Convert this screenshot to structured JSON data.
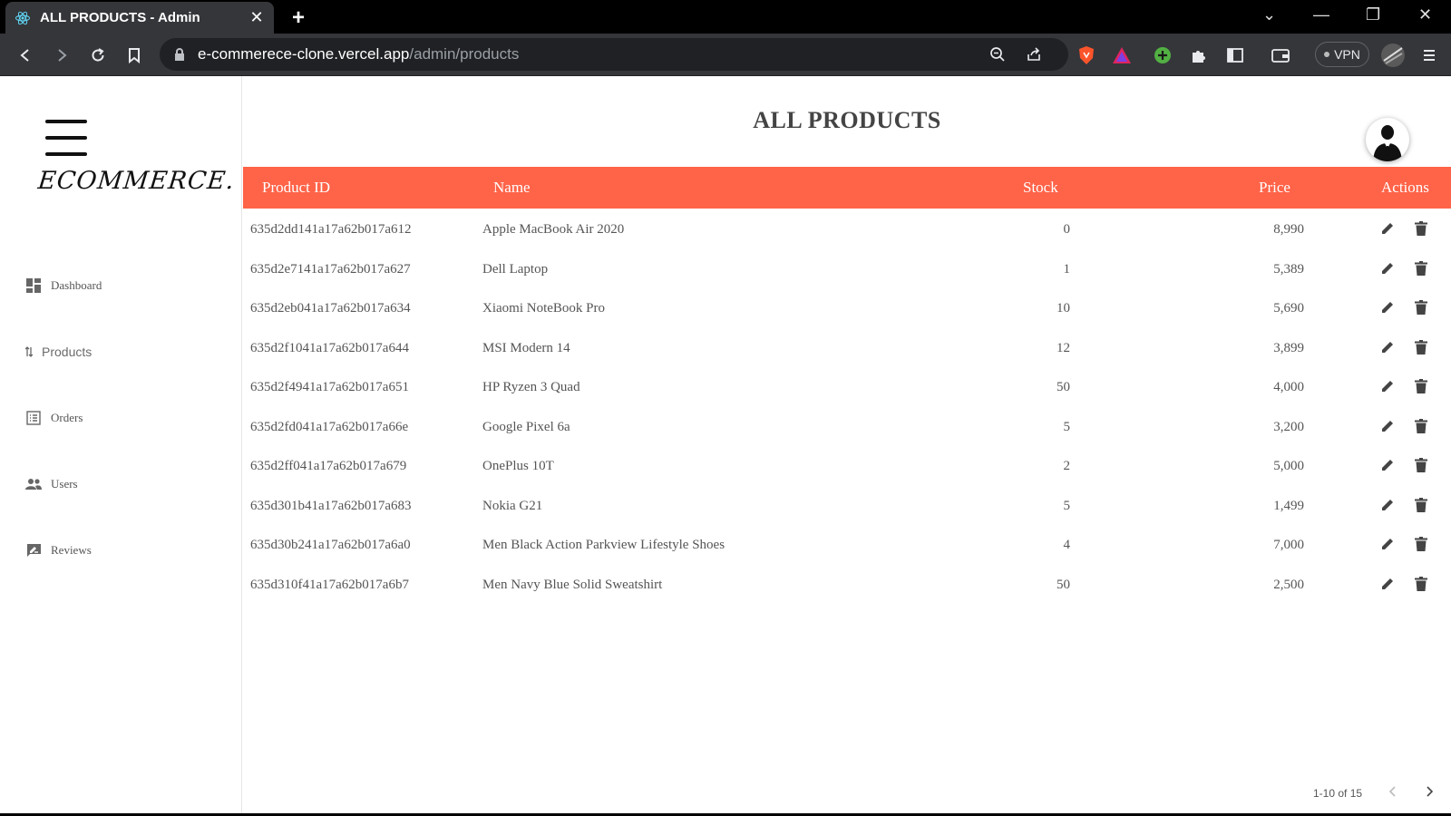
{
  "browser": {
    "tab_title": "ALL PRODUCTS - Admin",
    "tab_close": "✕",
    "new_tab": "+",
    "url_host": "e-commerece-clone.vercel.app",
    "url_path": "/admin/products",
    "vpn_label": "VPN",
    "window_controls": [
      "⌄",
      "—",
      "❐",
      "✕"
    ]
  },
  "sidebar": {
    "logo": "ECOMMERCE.",
    "items": [
      {
        "label": "Dashboard",
        "icon": "dashboard-icon"
      },
      {
        "label": "Products",
        "icon": "import-export-icon"
      },
      {
        "label": "Orders",
        "icon": "list-alt-icon"
      },
      {
        "label": "Users",
        "icon": "people-icon"
      },
      {
        "label": "Reviews",
        "icon": "rate-review-icon"
      }
    ]
  },
  "main": {
    "title": "ALL PRODUCTS",
    "columns": [
      "Product ID",
      "Name",
      "Stock",
      "Price",
      "Actions"
    ],
    "rows": [
      {
        "id": "635d2dd141a17a62b017a612",
        "name": "Apple MacBook Air 2020",
        "stock": "0",
        "price": "8,990"
      },
      {
        "id": "635d2e7141a17a62b017a627",
        "name": "Dell Laptop",
        "stock": "1",
        "price": "5,389"
      },
      {
        "id": "635d2eb041a17a62b017a634",
        "name": "Xiaomi NoteBook Pro",
        "stock": "10",
        "price": "5,690"
      },
      {
        "id": "635d2f1041a17a62b017a644",
        "name": "MSI Modern 14",
        "stock": "12",
        "price": "3,899"
      },
      {
        "id": "635d2f4941a17a62b017a651",
        "name": "HP Ryzen 3 Quad",
        "stock": "50",
        "price": "4,000"
      },
      {
        "id": "635d2fd041a17a62b017a66e",
        "name": "Google Pixel 6a",
        "stock": "5",
        "price": "3,200"
      },
      {
        "id": "635d2ff041a17a62b017a679",
        "name": "OnePlus 10T",
        "stock": "2",
        "price": "5,000"
      },
      {
        "id": "635d301b41a17a62b017a683",
        "name": "Nokia G21",
        "stock": "5",
        "price": "1,499"
      },
      {
        "id": "635d30b241a17a62b017a6a0",
        "name": "Men Black Action Parkview Lifestyle Shoes",
        "stock": "4",
        "price": "7,000"
      },
      {
        "id": "635d310f41a17a62b017a6b7",
        "name": "Men Navy Blue Solid Sweatshirt",
        "stock": "50",
        "price": "2,500"
      }
    ],
    "pagination": "1-10 of 15"
  },
  "colors": {
    "header_accent": "#ff6348",
    "chrome_dark": "#35363a"
  }
}
